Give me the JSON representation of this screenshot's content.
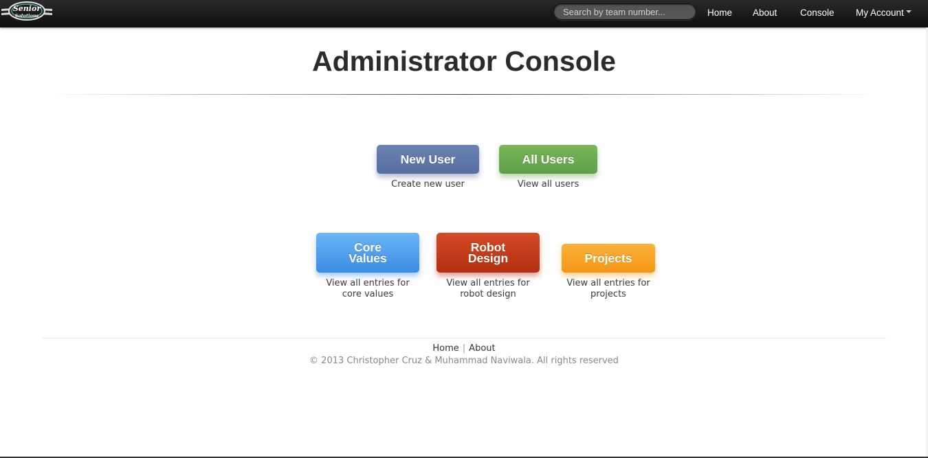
{
  "navbar": {
    "brand_alt": "Senior Solutions",
    "search_placeholder": "Search by team number...",
    "links": [
      "Home",
      "About",
      "Console",
      "My Account"
    ]
  },
  "header": {
    "title": "Administrator Console"
  },
  "tiles": [
    {
      "label_lines": [
        "New User"
      ],
      "caption_lines": [
        "Create new user"
      ],
      "color": "#5f76a9"
    },
    {
      "label_lines": [
        "All Users"
      ],
      "caption_lines": [
        "View all users"
      ],
      "color": "#6aab4f"
    },
    {
      "label_lines": [
        "Core",
        "Values"
      ],
      "caption_lines": [
        "View all entries for",
        "core values"
      ],
      "color": "#4d9cec"
    },
    {
      "label_lines": [
        "Robot",
        "Design"
      ],
      "caption_lines": [
        "View all entries for",
        "robot design"
      ],
      "color": "#c33d1b"
    },
    {
      "label_lines": [
        "Projects"
      ],
      "caption_lines": [
        "View all entries for",
        "projects"
      ],
      "color": "#f7a326"
    }
  ],
  "footer": {
    "links": [
      "Home",
      "About"
    ],
    "separator": "|",
    "copyright": "© 2013 Christopher Cruz & Muhammad Naviwala. All rights reserved"
  }
}
